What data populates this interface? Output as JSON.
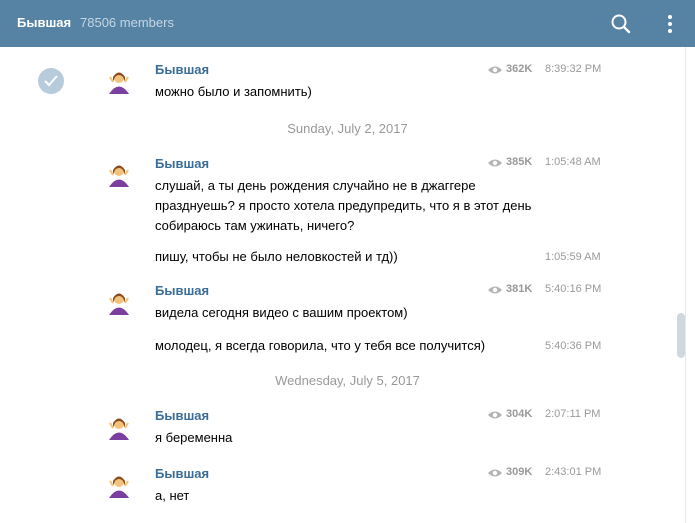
{
  "header": {
    "title": "Бывшая",
    "members": "78506 members"
  },
  "messages": [
    {
      "author": "Бывшая",
      "views": "362K",
      "time": "8:39:32 PM",
      "text": [
        "можно было и запомнить)"
      ]
    },
    {
      "date": "Sunday, July 2, 2017"
    },
    {
      "author": "Бывшая",
      "views": "385K",
      "time": "1:05:48 AM",
      "text": [
        "слушай, а ты день рождения случайно не в джаггере",
        "празднуешь? я просто хотела предупредить, что я в этот день",
        "собираюсь там ужинать, ничего?"
      ]
    },
    {
      "time": "1:05:59 AM",
      "text": [
        "пишу, чтобы не было неловкостей и тд))"
      ]
    },
    {
      "author": "Бывшая",
      "views": "381K",
      "time": "5:40:16 PM",
      "text": [
        "видела сегодня видео с вашим проектом)"
      ]
    },
    {
      "time": "5:40:36 PM",
      "text": [
        "молодец, я всегда говорила, что у тебя все получится)"
      ]
    },
    {
      "date": "Wednesday, July 5, 2017"
    },
    {
      "author": "Бывшая",
      "views": "304K",
      "time": "2:07:11 PM",
      "text": [
        "я беременна"
      ]
    },
    {
      "author": "Бывшая",
      "views": "309K",
      "time": "2:43:01 PM",
      "text": [
        "а, нет"
      ]
    }
  ],
  "colors": {
    "header_bg": "#5682a3",
    "author": "#3a6d99",
    "meta": "#999999",
    "check": "#b7cbdb"
  },
  "icons": {
    "search": "search-icon",
    "menu": "more-vertical-icon",
    "eye": "eye-icon",
    "select": "check-icon",
    "avatar": "woman-emoji-avatar-icon"
  }
}
